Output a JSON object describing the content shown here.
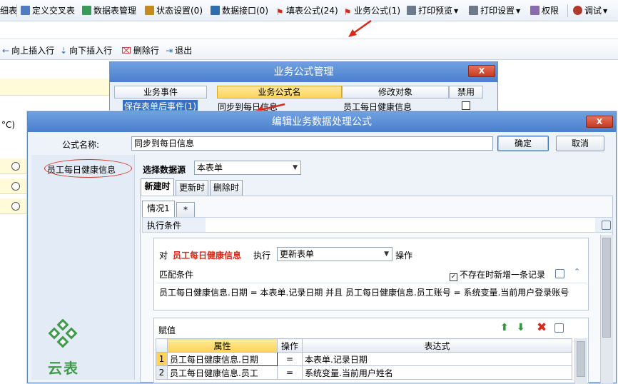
{
  "toolbar": {
    "items": [
      {
        "label": "细表"
      },
      {
        "label": "定义交叉表"
      },
      {
        "label": "数据表管理"
      },
      {
        "label": "状态设置(0)"
      },
      {
        "label": "数据接口(0)"
      },
      {
        "label": "填表公式(24)"
      },
      {
        "label": "业务公式(1)"
      },
      {
        "label": "打印预览"
      },
      {
        "label": "打印设置"
      },
      {
        "label": "权限"
      },
      {
        "label": "调试"
      }
    ]
  },
  "actionbar": {
    "insert_up": "向上插入行",
    "insert_down": "向下插入行",
    "delete_row": "删除行",
    "exit": "退出"
  },
  "background_form": {
    "temp_label": "°C)"
  },
  "biz_dialog": {
    "title": "业务公式管理",
    "close": "X",
    "col_event": "业务事件",
    "col_name": "业务公式名",
    "col_target": "修改对象",
    "col_disabled": "禁用",
    "event_value": "保存表单后事件(1)",
    "name_value": "同步到每日信息",
    "target_value": "员工每日健康信息"
  },
  "edit_dialog": {
    "title": "编辑业务数据处理公式",
    "close": "X",
    "name_label": "公式名称:",
    "name_value": "同步到每日信息",
    "ok": "确定",
    "cancel": "取消",
    "left_item": "员工每日健康信息",
    "datasource_label": "选择数据源",
    "datasource_value": "本表单",
    "tabs": [
      "新建时",
      "更新时",
      "删除时"
    ],
    "subtab": "情况1",
    "subtab_add": "*",
    "exec_cond": "执行条件",
    "op_prefix": "对",
    "op_target": "员工每日健康信息",
    "op_exec": "执行",
    "op_value": "更新表单",
    "op_suffix": "操作",
    "match_label": "匹配条件",
    "match_option": "不存在时新增一条记录",
    "match_expr": "员工每日健康信息.日期 = 本表单.记录日期 并且 员工每日健康信息.员工账号 = 系统变量.当前用户登录账号",
    "assign_label": "赋值",
    "grid_headers": [
      "属性",
      "操作",
      "表达式"
    ],
    "grid_rows": [
      {
        "no": "1",
        "attr": "员工每日健康信息.日期",
        "op": "=",
        "expr": "本表单.记录日期"
      },
      {
        "no": "2",
        "attr": "员工每日健康信息.员工",
        "op": "=",
        "expr": "系统变量.当前用户姓名"
      }
    ],
    "logo_text": "云表"
  },
  "colors": {
    "title_bar": "#4a7fcd",
    "accent_red": "#d62a1a",
    "selected_yellow": "#fdd35e"
  }
}
